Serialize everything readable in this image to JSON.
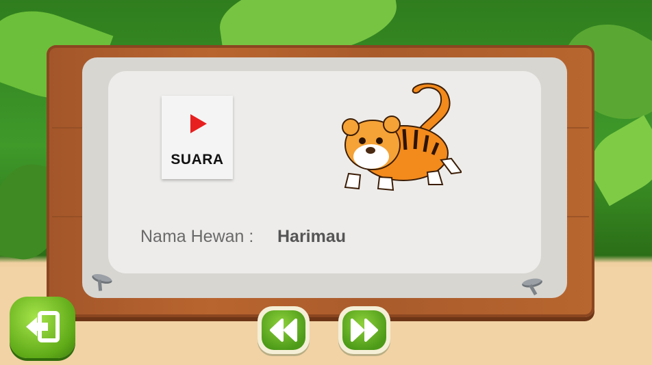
{
  "sound_card": {
    "icon": "play-icon",
    "label": "SUARA"
  },
  "animal_image": {
    "icon": "tiger-illustration"
  },
  "info": {
    "name_label": "Nama Hewan :",
    "name_value": "Harimau"
  },
  "controls": {
    "exit_icon": "exit-icon",
    "prev_icon": "rewind-icon",
    "next_icon": "fast-forward-icon"
  },
  "colors": {
    "play_red": "#e81f1f",
    "button_green": "#5faa18",
    "board_brown": "#b9652f"
  }
}
